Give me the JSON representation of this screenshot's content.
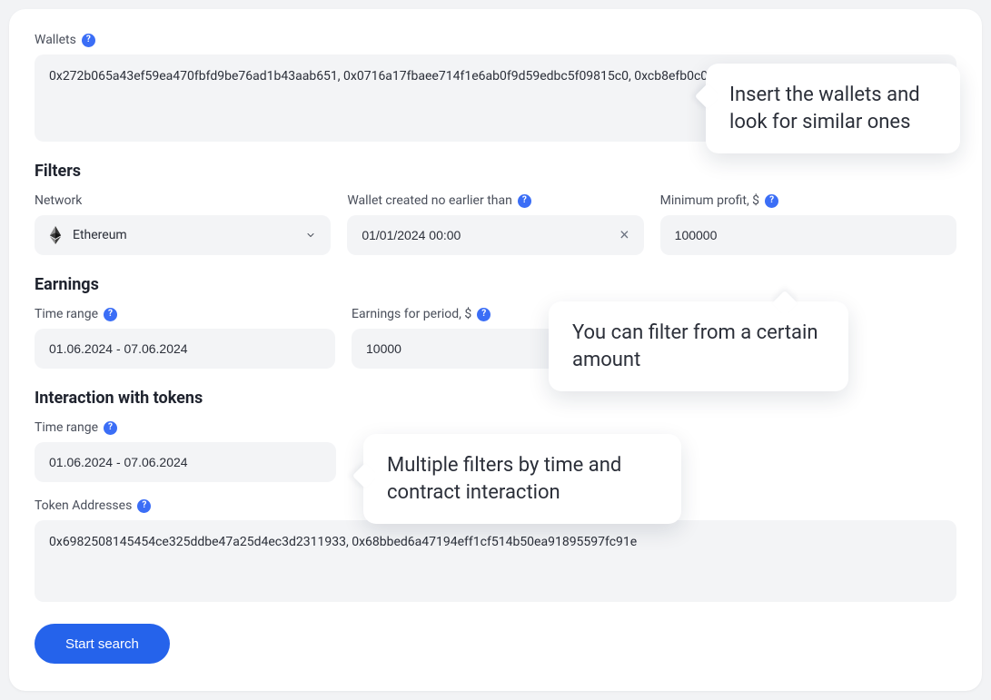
{
  "wallets": {
    "label": "Wallets",
    "value": "0x272b065a43ef59ea470fbfd9be76ad1b43aab651, 0x0716a17fbaee714f1e6ab0f9d59edbc5f09815c0, 0xcb8efb0c065071e4110932858a84365a80c8fef0"
  },
  "sections": {
    "filters": "Filters",
    "earnings": "Earnings",
    "interaction": "Interaction with tokens"
  },
  "filters": {
    "network": {
      "label": "Network",
      "value": "Ethereum"
    },
    "created": {
      "label": "Wallet created no earlier than",
      "value": "01/01/2024 00:00"
    },
    "minProfit": {
      "label": "Minimum profit, $",
      "value": "100000"
    }
  },
  "earnings": {
    "timeRange": {
      "label": "Time range",
      "value": "01.06.2024 - 07.06.2024"
    },
    "period": {
      "label": "Earnings for period, $",
      "value": "10000"
    }
  },
  "interaction": {
    "timeRange": {
      "label": "Time range",
      "value": "01.06.2024 - 07.06.2024"
    },
    "tokenAddresses": {
      "label": "Token Addresses",
      "value": "0x6982508145454ce325ddbe47a25d4ec3d2311933, 0x68bbed6a47194eff1cf514b50ea91895597fc91e"
    }
  },
  "submit": "Start search",
  "bubbles": {
    "b1": "Insert the wallets and look for similar ones",
    "b2": "You can filter from a certain amount",
    "b3": "Multiple filters by time and contract interaction"
  },
  "help": "?"
}
